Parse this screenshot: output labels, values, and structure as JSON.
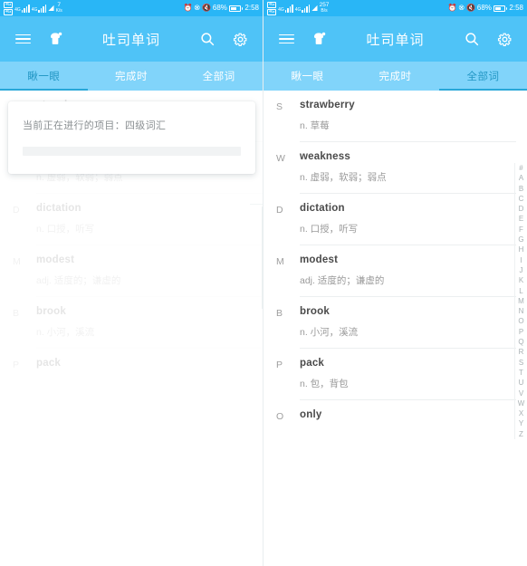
{
  "status_bar": {
    "sim1_label": "4G",
    "sim2_label": "4G",
    "signal_left_label": "4G",
    "signal_right_label": "4G",
    "wifi_icon": "wifi-icon",
    "alarm_icon": "alarm-icon",
    "bluetooth_icon": "bluetooth-icon",
    "mute_icon": "mute-icon",
    "left_net_speed_value": "7",
    "left_net_speed_unit": "K/s",
    "right_net_speed_value": "257",
    "right_net_speed_unit": "B/s",
    "battery_percent": "68%",
    "clock": "2:58"
  },
  "app_bar": {
    "menu_icon": "hamburger-menu-icon",
    "toast_icon": "toast-bread-icon",
    "title": "吐司单词",
    "search_icon": "search-icon",
    "settings_icon": "gear-icon"
  },
  "panels": [
    {
      "id": "left",
      "tabs": [
        {
          "label": "瞅一眼",
          "active": true
        },
        {
          "label": "完成时",
          "active": false
        },
        {
          "label": "全部词",
          "active": false
        }
      ],
      "active_tab_index": 0,
      "dialog": {
        "visible": true,
        "message": "当前正在进行的项目：四级词汇",
        "progress_percent": 0
      },
      "alphabet_index_visible": false,
      "words": [
        {
          "letter": "S",
          "word": "strawberry",
          "definition": "n. 草莓"
        },
        {
          "letter": "W",
          "word": "weakness",
          "definition": "n. 虚弱，软弱；弱点"
        },
        {
          "letter": "D",
          "word": "dictation",
          "definition": "n. 口授，听写"
        },
        {
          "letter": "M",
          "word": "modest",
          "definition": "adj. 适度的；谦虚的"
        },
        {
          "letter": "B",
          "word": "brook",
          "definition": "n. 小河，溪流"
        },
        {
          "letter": "P",
          "word": "pack",
          "definition": ""
        }
      ]
    },
    {
      "id": "right",
      "tabs": [
        {
          "label": "瞅一眼",
          "active": false
        },
        {
          "label": "完成时",
          "active": false
        },
        {
          "label": "全部词",
          "active": true
        }
      ],
      "active_tab_index": 2,
      "dialog": {
        "visible": false,
        "message": "",
        "progress_percent": 0
      },
      "alphabet_index_visible": true,
      "alphabet_index": [
        "#",
        "A",
        "B",
        "C",
        "D",
        "E",
        "F",
        "G",
        "H",
        "I",
        "J",
        "K",
        "L",
        "M",
        "N",
        "O",
        "P",
        "Q",
        "R",
        "S",
        "T",
        "U",
        "V",
        "W",
        "X",
        "Y",
        "Z"
      ],
      "words": [
        {
          "letter": "S",
          "word": "strawberry",
          "definition": "n. 草莓"
        },
        {
          "letter": "W",
          "word": "weakness",
          "definition": "n. 虚弱，软弱；弱点"
        },
        {
          "letter": "D",
          "word": "dictation",
          "definition": "n. 口授，听写"
        },
        {
          "letter": "M",
          "word": "modest",
          "definition": "adj. 适度的；谦虚的"
        },
        {
          "letter": "B",
          "word": "brook",
          "definition": "n. 小河，溪流"
        },
        {
          "letter": "P",
          "word": "pack",
          "definition": "n. 包，背包"
        },
        {
          "letter": "O",
          "word": "only",
          "definition": ""
        }
      ]
    }
  ],
  "colors": {
    "status_bar": "#29b6f6",
    "app_bar": "#4fc3f7",
    "tab_bar": "#81d4fa",
    "tab_active_text": "#2196c4",
    "tab_indicator": "#29a7d8",
    "word_text": "#4a4a4a",
    "definition_text": "#9a9a9a"
  }
}
